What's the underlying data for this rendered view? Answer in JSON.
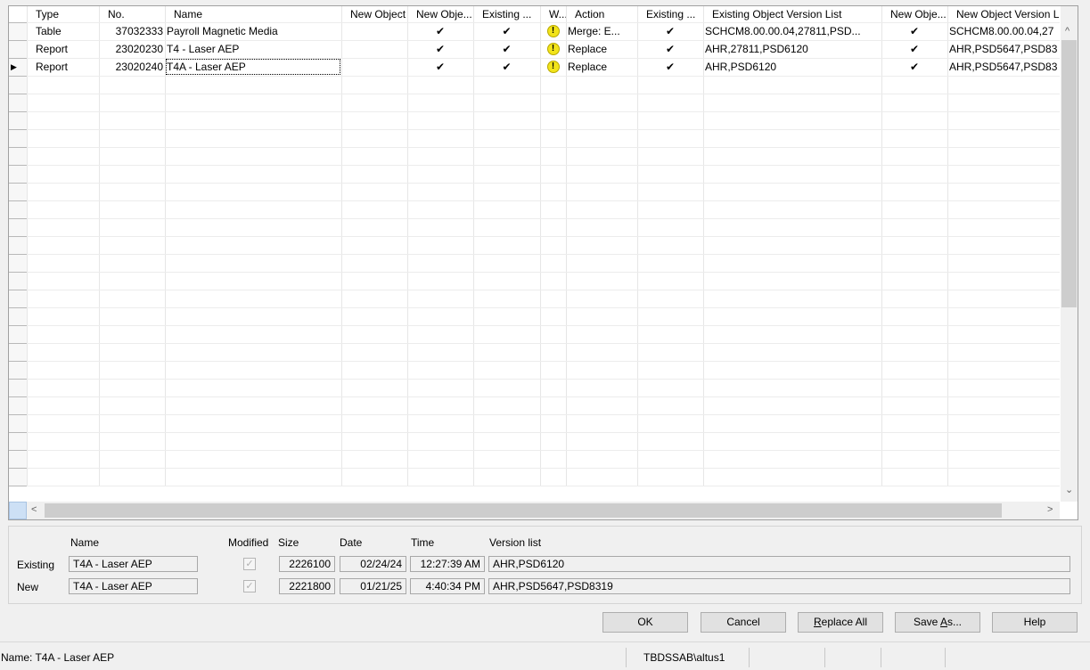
{
  "columns": [
    {
      "key": "type",
      "label": "Type"
    },
    {
      "key": "no",
      "label": "No."
    },
    {
      "key": "name",
      "label": "Name"
    },
    {
      "key": "new_object",
      "label": "New Object"
    },
    {
      "key": "new_obje_1",
      "label": "New Obje..."
    },
    {
      "key": "existing_1",
      "label": "Existing ..."
    },
    {
      "key": "w",
      "label": "W..."
    },
    {
      "key": "action",
      "label": "Action"
    },
    {
      "key": "existing_2",
      "label": "Existing ..."
    },
    {
      "key": "existing_version_list",
      "label": "Existing Object Version List"
    },
    {
      "key": "new_obje_2",
      "label": "New Obje..."
    },
    {
      "key": "new_version_list",
      "label": "New Object Version Li"
    }
  ],
  "rows": [
    {
      "type": "Table",
      "no": "37032333",
      "name": "Payroll Magnetic Media",
      "check": "✔",
      "warn": "!",
      "action": "Merge: E...",
      "existing_version_list": "SCHCM8.00.00.04,27811,PSD...",
      "new_version_list": "SCHCM8.00.00.04,27"
    },
    {
      "type": "Report",
      "no": "23020230",
      "name": "T4 - Laser AEP",
      "check": "✔",
      "warn": "!",
      "action": "Replace",
      "existing_version_list": "AHR,27811,PSD6120",
      "new_version_list": "AHR,PSD5647,PSD83"
    },
    {
      "type": "Report",
      "no": "23020240",
      "name": "T4A - Laser AEP",
      "check": "✔",
      "warn": "!",
      "action": "Replace",
      "existing_version_list": "AHR,PSD6120",
      "new_version_list": "AHR,PSD5647,PSD83"
    }
  ],
  "row_pointer": "▶",
  "scroll": {
    "up": "^",
    "down": "⌄",
    "left": "<",
    "right": ">"
  },
  "details": {
    "headers": {
      "name": "Name",
      "modified": "Modified",
      "size": "Size",
      "date": "Date",
      "time": "Time",
      "version_list": "Version list"
    },
    "existing": {
      "label": "Existing",
      "name": "T4A - Laser AEP",
      "modified": "✓",
      "size": "2226100",
      "date": "02/24/24",
      "time": "12:27:39 AM",
      "version_list": "AHR,PSD6120"
    },
    "new": {
      "label": "New",
      "name": "T4A - Laser AEP",
      "modified": "✓",
      "size": "2221800",
      "date": "01/21/25",
      "time": "4:40:34 PM",
      "version_list": "AHR,PSD5647,PSD8319"
    }
  },
  "buttons": {
    "ok": "OK",
    "cancel": "Cancel",
    "replace_all_u": "R",
    "replace_all_rest": "eplace All",
    "save_as_pre": "Save ",
    "save_as_u": "A",
    "save_as_rest": "s...",
    "help": "Help"
  },
  "status": {
    "name": "Name: T4A - Laser AEP",
    "user": "TBDSSAB\\altus1"
  }
}
